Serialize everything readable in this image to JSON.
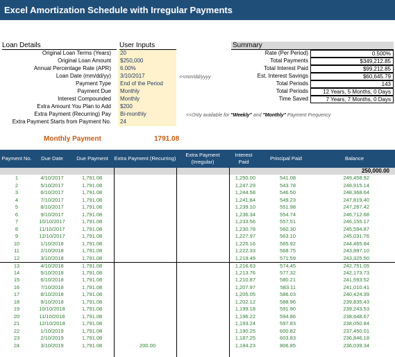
{
  "title": "Excel Amortization Schedule with Irregular Payments",
  "loan_details": {
    "heading": "Loan Details",
    "inputs_heading": "User Inputs",
    "rows": [
      {
        "label": "Original Loan Terms (Years)",
        "value": "20"
      },
      {
        "label": "Original Loan Amount",
        "value": "$250,000"
      },
      {
        "label": "Annual Percentage Rate (APR)",
        "value": "6.00%"
      },
      {
        "label": "Loan Date (mm/dd/yy)",
        "value": "3/10/2017"
      },
      {
        "label": "Payment Type",
        "value": "End of the Period"
      },
      {
        "label": "Payment Due",
        "value": "Monthly"
      },
      {
        "label": "Interest Compounded",
        "value": "Monthly"
      },
      {
        "label": "Extra Amount You Plan to Add",
        "value": "$200"
      },
      {
        "label": "Extra Payment (Recurring) Pay",
        "value": "Bi-monthly"
      },
      {
        "label": "Extra Payment Starts from Payment No.",
        "value": "24"
      }
    ],
    "date_hint": "<<mm/dd/yyyy",
    "freq_note_prefix": "<<Only available for",
    "freq_note_weekly": "\"Weekly\"",
    "freq_note_and": "and",
    "freq_note_monthly": "\"Monthly\"",
    "freq_note_suffix": "Payment Frequency"
  },
  "summary": {
    "heading": "Summary",
    "rows": [
      {
        "label": "Rate (Per Period)",
        "value": "0.500%"
      },
      {
        "label": "Total Payments",
        "value": "$349,212.85"
      },
      {
        "label": "Total Interest Paid",
        "value": "$99,212.85"
      },
      {
        "label": "Est. Interest Savings",
        "value": "$60,645.79"
      },
      {
        "label": "Total Periods",
        "value": "143"
      },
      {
        "label": "Total Periods",
        "value": "12 Years, 5 Months, 0 Days"
      },
      {
        "label": "Time Saved",
        "value": "7 Years, 7 Months, 0 Days"
      }
    ]
  },
  "monthly_payment": {
    "label": "Monthly Payment",
    "value": "1791.08"
  },
  "table": {
    "headers": [
      "Payment No.",
      "Due Date",
      "Due Payment",
      "Extra Payment (Recurring)",
      "Extra Payment (Irregular)",
      "Interest Paid",
      "Principal Paid",
      "Balance"
    ],
    "start_balance": "250,000.00",
    "rows": [
      [
        "1",
        "4/10/2017",
        "1,791.08",
        "",
        "",
        "1,250.00",
        "541.08",
        "249,458.92"
      ],
      [
        "2",
        "5/10/2017",
        "1,791.08",
        "",
        "",
        "1,247.29",
        "543.78",
        "248,915.14"
      ],
      [
        "3",
        "6/10/2017",
        "1,791.08",
        "",
        "",
        "1,244.58",
        "546.50",
        "248,368.64"
      ],
      [
        "4",
        "7/10/2017",
        "1,791.08",
        "",
        "",
        "1,241.84",
        "549.23",
        "247,819.40"
      ],
      [
        "5",
        "8/10/2017",
        "1,791.08",
        "",
        "",
        "1,239.10",
        "551.98",
        "247,267.42"
      ],
      [
        "6",
        "9/10/2017",
        "1,791.08",
        "",
        "",
        "1,236.34",
        "554.74",
        "246,712.68"
      ],
      [
        "7",
        "10/10/2017",
        "1,791.08",
        "",
        "",
        "1,233.56",
        "557.51",
        "246,155.17"
      ],
      [
        "8",
        "11/10/2017",
        "1,791.08",
        "",
        "",
        "1,230.78",
        "560.30",
        "245,594.87"
      ],
      [
        "9",
        "12/10/2017",
        "1,791.08",
        "",
        "",
        "1,227.97",
        "563.10",
        "245,031.76"
      ],
      [
        "10",
        "1/10/2018",
        "1,791.08",
        "",
        "",
        "1,225.16",
        "565.92",
        "244,465.84"
      ],
      [
        "11",
        "2/10/2018",
        "1,791.08",
        "",
        "",
        "1,222.33",
        "568.75",
        "243,897.10"
      ],
      [
        "12",
        "3/10/2018",
        "1,791.08",
        "",
        "",
        "1,219.49",
        "571.59",
        "243,325.50"
      ],
      [
        "13",
        "4/10/2018",
        "1,791.08",
        "",
        "",
        "1,216.63",
        "574.45",
        "242,751.05"
      ],
      [
        "14",
        "5/10/2018",
        "1,791.08",
        "",
        "",
        "1,213.76",
        "577.32",
        "242,173.73"
      ],
      [
        "15",
        "6/10/2018",
        "1,791.08",
        "",
        "",
        "1,210.87",
        "580.21",
        "241,593.52"
      ],
      [
        "16",
        "7/10/2018",
        "1,791.08",
        "",
        "",
        "1,207.97",
        "583.11",
        "241,010.41"
      ],
      [
        "17",
        "8/10/2018",
        "1,791.08",
        "",
        "",
        "1,205.05",
        "586.03",
        "240,424.39"
      ],
      [
        "18",
        "9/10/2018",
        "1,791.08",
        "",
        "",
        "1,202.12",
        "588.96",
        "239,835.43"
      ],
      [
        "19",
        "10/10/2018",
        "1,791.08",
        "",
        "",
        "1,199.18",
        "591.90",
        "239,243.53"
      ],
      [
        "20",
        "11/10/2018",
        "1,791.08",
        "",
        "",
        "1,196.22",
        "594.86",
        "238,648.67"
      ],
      [
        "21",
        "12/10/2018",
        "1,791.08",
        "",
        "",
        "1,193.24",
        "597.83",
        "238,050.84"
      ],
      [
        "22",
        "1/10/2019",
        "1,791.08",
        "",
        "",
        "1,190.25",
        "600.82",
        "237,450.01"
      ],
      [
        "23",
        "2/10/2019",
        "1,791.08",
        "",
        "",
        "1,187.25",
        "603.83",
        "236,846.18"
      ],
      [
        "24",
        "3/10/2019",
        "1,791.08",
        "200.00",
        "",
        "1,184.23",
        "806.85",
        "236,039.34"
      ]
    ]
  }
}
